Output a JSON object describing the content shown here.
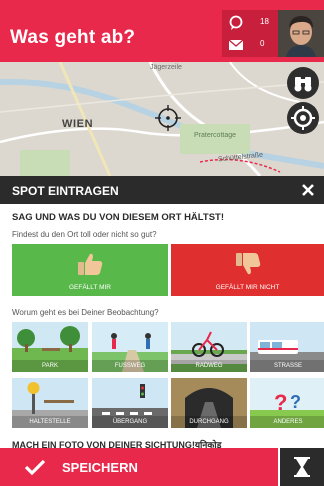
{
  "header": {
    "title": "Was geht ab?",
    "comments_count": "18",
    "messages_count": "0"
  },
  "map": {
    "label_city": "WIEN",
    "label_north": "Jägerzeile",
    "label_east": "Pratercottage",
    "label_street": "Schüttelstraße"
  },
  "panel": {
    "title": "SPOT EINTRAGEN",
    "heading": "SAG UND WAS DU VON DIESEM ORT HÄLTST!",
    "question": "Findest du den Ort toll oder nicht so gut?",
    "like_label": "GEFÄLLT MIR",
    "dislike_label": "GEFÄLLT MIR NICHT",
    "category_question": "Worum geht es bei Deiner Beobachtung?",
    "categories": [
      {
        "label": "PARK",
        "color": "#6fb84f"
      },
      {
        "label": "FUSSWEG",
        "color": "#7cc36a"
      },
      {
        "label": "RADWEG",
        "color": "#8c8c8c"
      },
      {
        "label": "STRASSE",
        "color": "#9fbfd8"
      },
      {
        "label": "HALTESTELLE",
        "color": "#8fb8d4"
      },
      {
        "label": "ÜBERGANG",
        "color": "#5b86a8"
      },
      {
        "label": "DURCHGANG",
        "color": "#c8a25a"
      },
      {
        "label": "ANDERES",
        "color": "#88c94f"
      }
    ],
    "photo_heading": "MACH EIN FOTO VON DEINER SICHTUNG!युनिकोड"
  },
  "bottom": {
    "save_label": "SPEICHERN"
  },
  "colors": {
    "brand": "#e8294b",
    "dark": "#2b2b2b",
    "like": "#58b84a",
    "dislike": "#e02f2f"
  }
}
